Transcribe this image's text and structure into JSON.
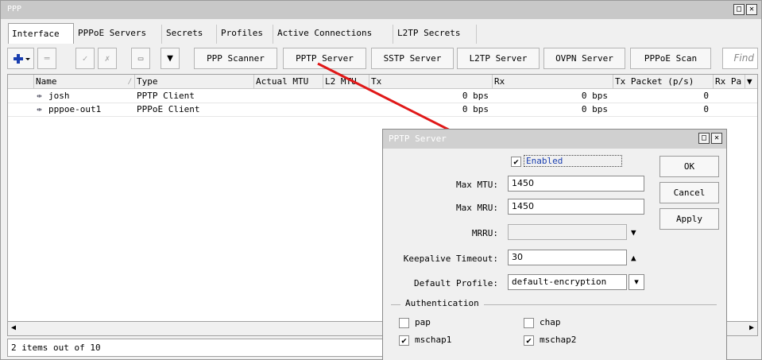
{
  "window": {
    "title": "PPP"
  },
  "tabs": [
    "Interface",
    "PPPoE Servers",
    "Secrets",
    "Profiles",
    "Active Connections",
    "L2TP Secrets"
  ],
  "toolbar": {
    "buttons": [
      "PPP Scanner",
      "PPTP Server",
      "SSTP Server",
      "L2TP Server",
      "OVPN Server",
      "PPPoE Scan"
    ],
    "find_placeholder": "Find"
  },
  "table": {
    "columns": [
      "Name",
      "Type",
      "Actual MTU",
      "L2 MTU",
      "Tx",
      "Rx",
      "Tx Packet (p/s)",
      "Rx Pa"
    ],
    "rows": [
      {
        "name": "josh",
        "type": "PPTP Client",
        "tx": "0 bps",
        "rx": "0 bps",
        "tx_packet": "0"
      },
      {
        "name": "pppoe-out1",
        "type": "PPPoE Client",
        "tx": "0 bps",
        "rx": "0 bps",
        "tx_packet": "0"
      }
    ]
  },
  "status": "2 items out of 10",
  "dialog": {
    "title": "PPTP Server",
    "enabled_label": "Enabled",
    "max_mtu_label": "Max MTU:",
    "max_mtu": "1450",
    "max_mru_label": "Max MRU:",
    "max_mru": "1450",
    "mrru_label": "MRRU:",
    "mrru": "",
    "keepalive_label": "Keepalive Timeout:",
    "keepalive": "30",
    "profile_label": "Default Profile:",
    "profile": "default-encryption",
    "auth_label": "Authentication",
    "auth": {
      "pap": "pap",
      "chap": "chap",
      "mschap1": "mschap1",
      "mschap2": "mschap2"
    },
    "buttons": {
      "ok": "OK",
      "cancel": "Cancel",
      "apply": "Apply"
    }
  }
}
